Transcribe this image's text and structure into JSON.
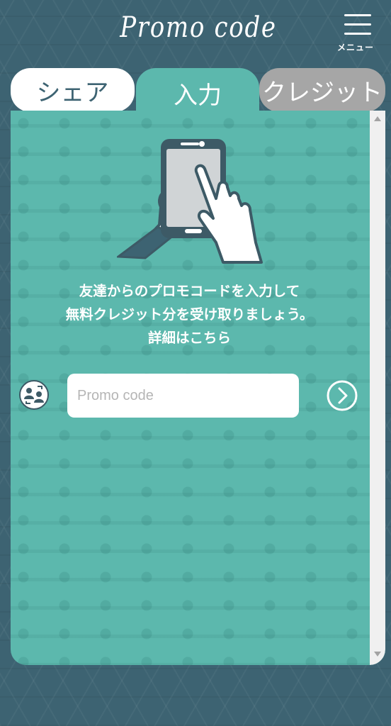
{
  "header": {
    "title": "Promo code",
    "menu_label": "メニュー"
  },
  "tabs": [
    {
      "label": "シェア",
      "active": false
    },
    {
      "label": "入力",
      "active": true
    },
    {
      "label": "クレジット",
      "active": false
    }
  ],
  "main": {
    "description_line1": "友達からのプロモコードを入力して",
    "description_line2": "無料クレジット分を受け取りましょう。",
    "details_link": "詳細はこちら",
    "promo_input": {
      "placeholder": "Promo code",
      "value": ""
    }
  },
  "colors": {
    "background": "#3d6372",
    "panel": "#5cb8ad",
    "inactive_tab": "#a6a6a6",
    "text_dark": "#3d6372"
  },
  "icons": [
    "menu-icon",
    "phone-tap-illustration",
    "friends-icon",
    "chevron-right-icon"
  ]
}
